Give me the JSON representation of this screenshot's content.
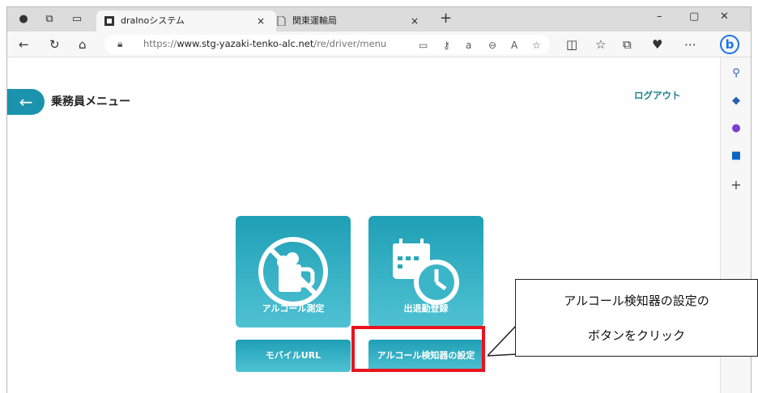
{
  "browser": {
    "tabs": [
      {
        "title": "draInoシステム",
        "close": "×"
      },
      {
        "title": "関東運輸局",
        "close": "×"
      }
    ],
    "new_tab": "+",
    "window_controls": {
      "minimize": "–",
      "maximize": "▢",
      "close": "✕"
    },
    "url_prefix": "https://",
    "url_host": "www.stg-yazaki-tenko-alc.net",
    "url_path": "/re/driver/menu"
  },
  "page": {
    "title": "乗務員メニュー",
    "logout": "ログアウト",
    "tiles": [
      {
        "label": "アルコール測定"
      },
      {
        "label": "出退勤登録"
      }
    ],
    "buttons": [
      {
        "label": "モバイルURL"
      },
      {
        "label": "アルコール検知器の設定"
      }
    ]
  },
  "callout": {
    "line1": "アルコール検知器の設定の",
    "line2": "ボタンをクリック"
  },
  "colors": {
    "accent": "#1c93ad",
    "highlight": "#e8141f"
  }
}
